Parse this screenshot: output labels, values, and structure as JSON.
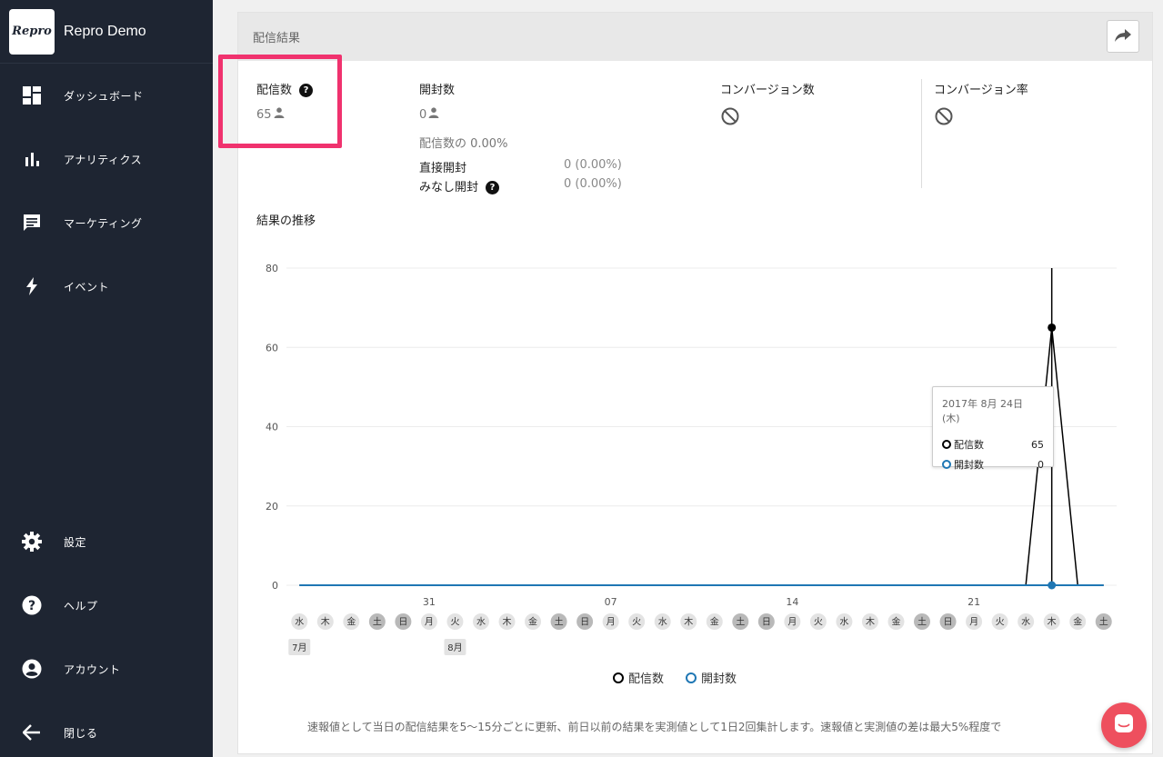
{
  "app": {
    "name": "Repro Demo",
    "logo_text": "Repro"
  },
  "sidebar": {
    "items": [
      {
        "label": "ダッシュボード",
        "icon": "dashboard-icon"
      },
      {
        "label": "アナリティクス",
        "icon": "bar-chart-icon"
      },
      {
        "label": "マーケティング",
        "icon": "message-icon"
      },
      {
        "label": "イベント",
        "icon": "bolt-icon"
      }
    ],
    "bottom_items": [
      {
        "label": "設定",
        "icon": "gear-icon"
      },
      {
        "label": "ヘルプ",
        "icon": "help-icon"
      },
      {
        "label": "アカウント",
        "icon": "account-icon"
      },
      {
        "label": "閉じる",
        "icon": "back-arrow-icon"
      }
    ]
  },
  "card": {
    "title": "配信結果",
    "share_icon": "share-icon"
  },
  "stats": {
    "delivered": {
      "label": "配信数",
      "value": "65"
    },
    "opened": {
      "label": "開封数",
      "value": "0",
      "rate": "配信数の 0.00%",
      "direct_label": "直接開封",
      "direct_value": "0 (0.00%)",
      "deemed_label": "みなし開封",
      "deemed_value": "0 (0.00%)"
    },
    "conversions": {
      "label": "コンバージョン数"
    },
    "conversion_rate": {
      "label": "コンバージョン率"
    }
  },
  "chart": {
    "title": "結果の推移",
    "tooltip": {
      "date": "2017年 8月 24日 (木)",
      "rows": [
        {
          "name": "配信数",
          "value": "65"
        },
        {
          "name": "開封数",
          "value": "0"
        }
      ]
    },
    "legend": [
      "配信数",
      "開封数"
    ]
  },
  "chart_data": {
    "type": "line",
    "ylim": [
      0,
      80
    ],
    "yticks": [
      0,
      20,
      40,
      60,
      80
    ],
    "x": [
      "2017-07-26",
      "2017-07-27",
      "2017-07-28",
      "2017-07-29",
      "2017-07-30",
      "2017-07-31",
      "2017-08-01",
      "2017-08-02",
      "2017-08-03",
      "2017-08-04",
      "2017-08-05",
      "2017-08-06",
      "2017-08-07",
      "2017-08-08",
      "2017-08-09",
      "2017-08-10",
      "2017-08-11",
      "2017-08-12",
      "2017-08-13",
      "2017-08-14",
      "2017-08-15",
      "2017-08-16",
      "2017-08-17",
      "2017-08-18",
      "2017-08-19",
      "2017-08-20",
      "2017-08-21",
      "2017-08-22",
      "2017-08-23",
      "2017-08-24",
      "2017-08-25",
      "2017-08-26"
    ],
    "weekdays": [
      "水",
      "木",
      "金",
      "土",
      "日",
      "月",
      "火",
      "水",
      "木",
      "金",
      "土",
      "日",
      "月",
      "火",
      "水",
      "木",
      "金",
      "土",
      "日",
      "月",
      "火",
      "水",
      "木",
      "金",
      "土",
      "日",
      "月",
      "火",
      "水",
      "木",
      "金",
      "土"
    ],
    "date_ticks": [
      {
        "label": "31",
        "index": 5
      },
      {
        "label": "07",
        "index": 12
      },
      {
        "label": "14",
        "index": 19
      },
      {
        "label": "21",
        "index": 26
      }
    ],
    "month_badges": [
      {
        "label": "7月",
        "index": 0
      },
      {
        "label": "8月",
        "index": 6
      }
    ],
    "series": [
      {
        "name": "配信数",
        "color": "#000000",
        "values": [
          0,
          0,
          0,
          0,
          0,
          0,
          0,
          0,
          0,
          0,
          0,
          0,
          0,
          0,
          0,
          0,
          0,
          0,
          0,
          0,
          0,
          0,
          0,
          0,
          0,
          0,
          0,
          0,
          0,
          65,
          0,
          0
        ]
      },
      {
        "name": "開封数",
        "color": "#1f77b4",
        "values": [
          0,
          0,
          0,
          0,
          0,
          0,
          0,
          0,
          0,
          0,
          0,
          0,
          0,
          0,
          0,
          0,
          0,
          0,
          0,
          0,
          0,
          0,
          0,
          0,
          0,
          0,
          0,
          0,
          0,
          0,
          0,
          0
        ]
      }
    ],
    "highlight_index": 29
  },
  "footnote": "速報値として当日の配信結果を5〜15分ごとに更新、前日以前の結果を実測値として1日2回集計します。速報値と実測値の差は最大5%程度で",
  "chat": {
    "icon": "chat-icon"
  }
}
